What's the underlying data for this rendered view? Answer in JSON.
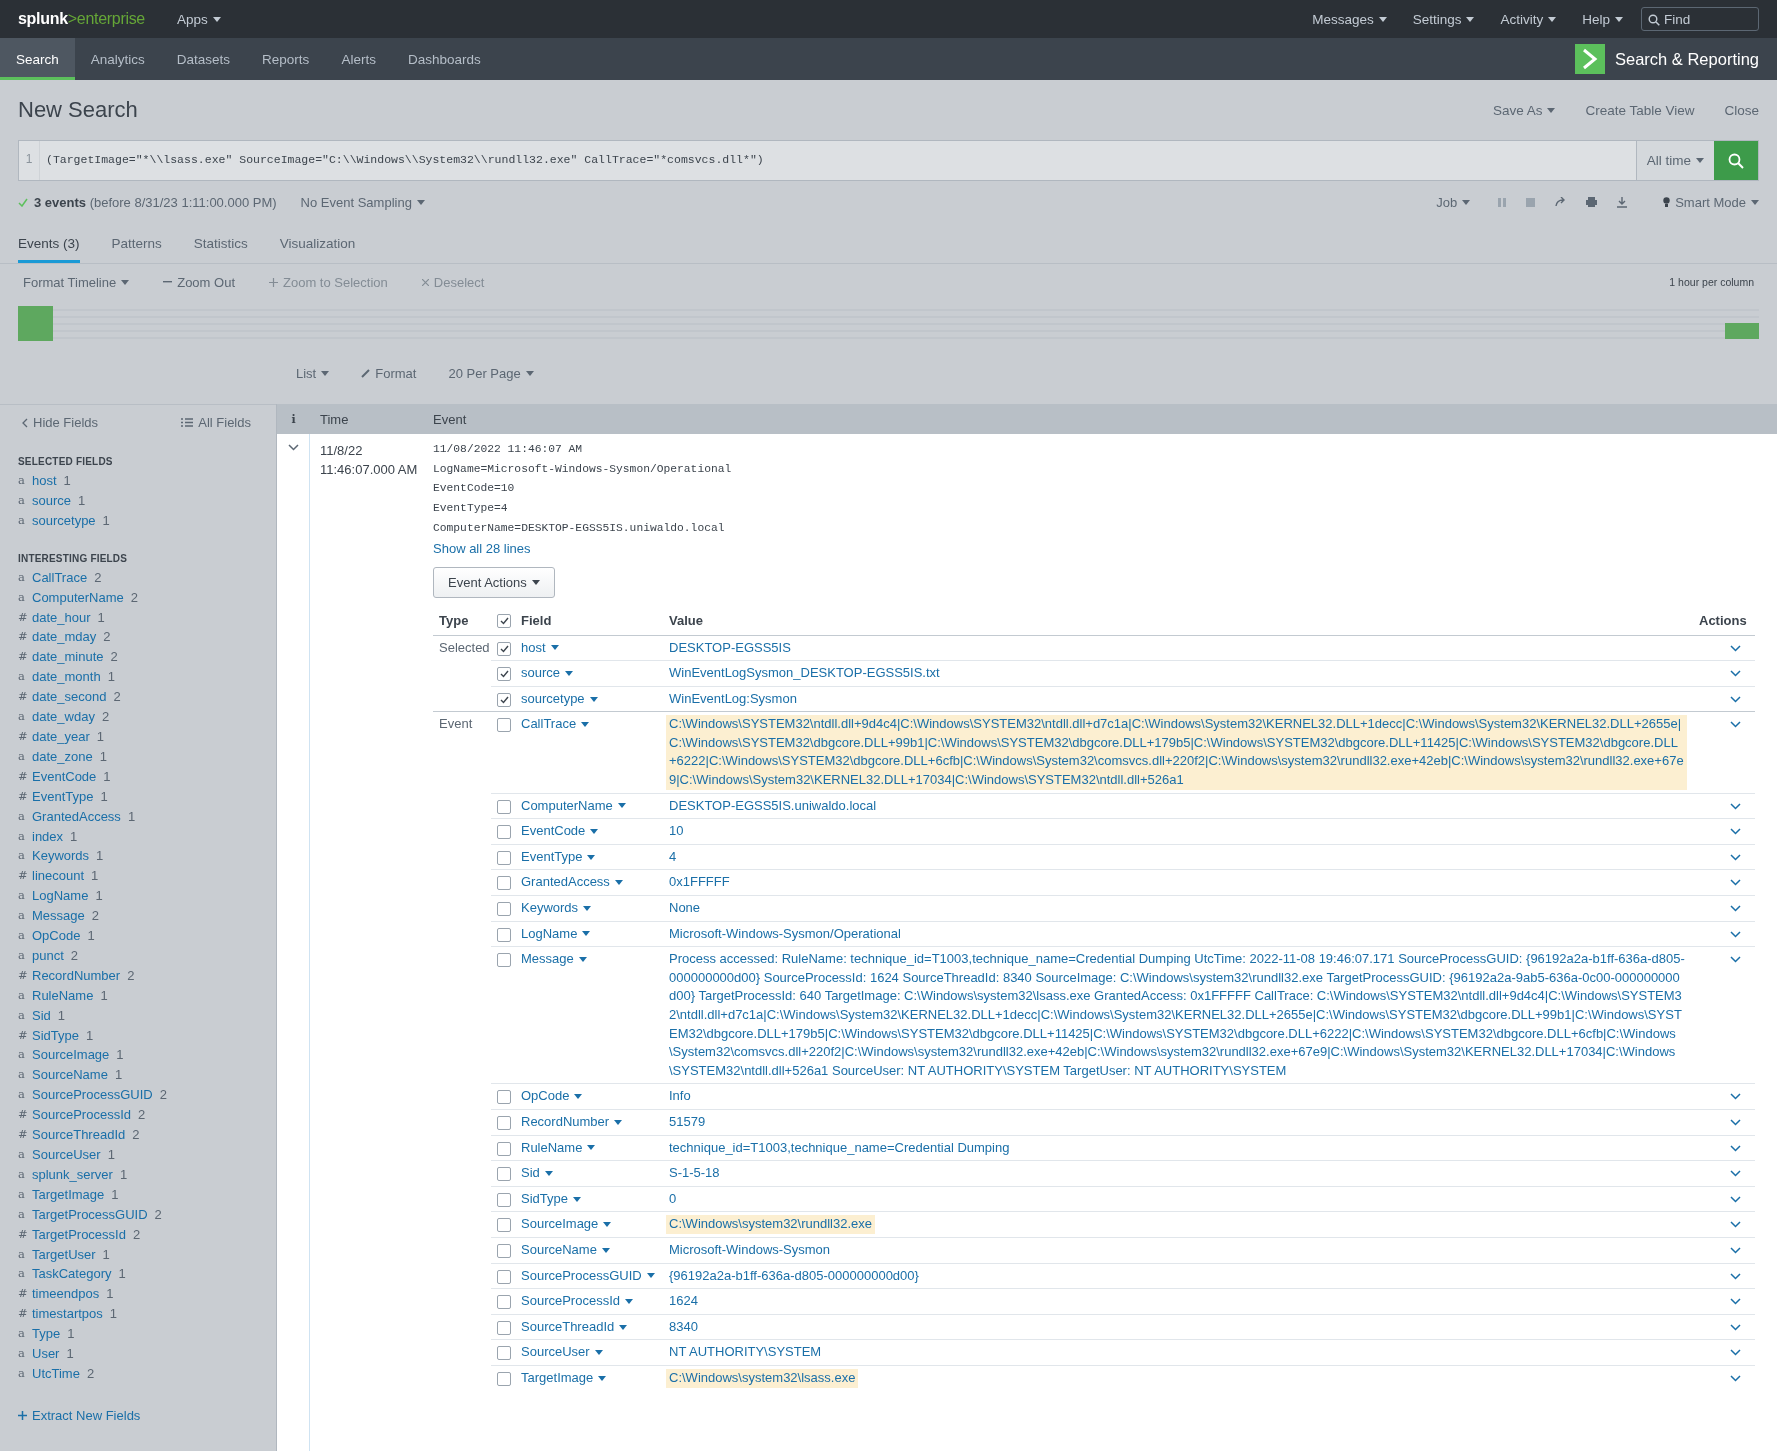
{
  "top_bar": {
    "logo": {
      "name": "splunk",
      "product": ">enterprise"
    },
    "apps": "Apps",
    "menus": [
      "Messages",
      "Settings",
      "Activity",
      "Help"
    ],
    "find": {
      "placeholder": "Find"
    }
  },
  "nav": {
    "items": [
      {
        "label": "Search",
        "selected": true
      },
      {
        "label": "Analytics",
        "selected": false
      },
      {
        "label": "Datasets",
        "selected": false
      },
      {
        "label": "Reports",
        "selected": false
      },
      {
        "label": "Alerts",
        "selected": false
      },
      {
        "label": "Dashboards",
        "selected": false
      }
    ],
    "app_title": "Search & Reporting"
  },
  "header": {
    "title": "New Search",
    "actions": [
      {
        "label": "Save As",
        "dropdown": true
      },
      {
        "label": "Create Table View",
        "dropdown": false
      },
      {
        "label": "Close",
        "dropdown": false
      }
    ]
  },
  "search": {
    "line_number": "1",
    "query": "(TargetImage=\"*\\\\lsass.exe\" SourceImage=\"C:\\\\Windows\\\\System32\\\\rundll32.exe\" CallTrace=\"*comsvcs.dll*\")",
    "time_range": "All time"
  },
  "status": {
    "count": "3 events",
    "detail": "(before 8/31/23 1:11:00.000 PM)",
    "sampling": "No Event Sampling",
    "job": "Job",
    "mode": "Smart Mode"
  },
  "tabs": [
    {
      "label": "Events (3)",
      "selected": true
    },
    {
      "label": "Patterns",
      "selected": false
    },
    {
      "label": "Statistics",
      "selected": false
    },
    {
      "label": "Visualization",
      "selected": false
    }
  ],
  "timeline": {
    "format": "Format Timeline",
    "zoom_out": {
      "label": "Zoom Out",
      "disabled": false
    },
    "zoom_selection": {
      "label": "Zoom to Selection",
      "disabled": true
    },
    "deselect": {
      "label": "Deselect",
      "disabled": true
    },
    "scale": "1 hour per column"
  },
  "results_toolbar": [
    {
      "label": "List",
      "kind": "dropdown"
    },
    {
      "label": "Format",
      "kind": "edit"
    },
    {
      "label": "20 Per Page",
      "kind": "dropdown"
    }
  ],
  "sidebar": {
    "hide": "Hide Fields",
    "all": "All Fields",
    "selected_heading": "SELECTED FIELDS",
    "selected_fields": [
      {
        "type": "a",
        "name": "host",
        "count": "1"
      },
      {
        "type": "a",
        "name": "source",
        "count": "1"
      },
      {
        "type": "a",
        "name": "sourcetype",
        "count": "1"
      }
    ],
    "interesting_heading": "INTERESTING FIELDS",
    "interesting_fields": [
      {
        "type": "a",
        "name": "CallTrace",
        "count": "2"
      },
      {
        "type": "a",
        "name": "ComputerName",
        "count": "2"
      },
      {
        "type": "#",
        "name": "date_hour",
        "count": "1"
      },
      {
        "type": "#",
        "name": "date_mday",
        "count": "2"
      },
      {
        "type": "#",
        "name": "date_minute",
        "count": "2"
      },
      {
        "type": "a",
        "name": "date_month",
        "count": "1"
      },
      {
        "type": "#",
        "name": "date_second",
        "count": "2"
      },
      {
        "type": "a",
        "name": "date_wday",
        "count": "2"
      },
      {
        "type": "#",
        "name": "date_year",
        "count": "1"
      },
      {
        "type": "a",
        "name": "date_zone",
        "count": "1"
      },
      {
        "type": "#",
        "name": "EventCode",
        "count": "1"
      },
      {
        "type": "#",
        "name": "EventType",
        "count": "1"
      },
      {
        "type": "a",
        "name": "GrantedAccess",
        "count": "1"
      },
      {
        "type": "a",
        "name": "index",
        "count": "1"
      },
      {
        "type": "a",
        "name": "Keywords",
        "count": "1"
      },
      {
        "type": "#",
        "name": "linecount",
        "count": "1"
      },
      {
        "type": "a",
        "name": "LogName",
        "count": "1"
      },
      {
        "type": "a",
        "name": "Message",
        "count": "2"
      },
      {
        "type": "a",
        "name": "OpCode",
        "count": "1"
      },
      {
        "type": "a",
        "name": "punct",
        "count": "2"
      },
      {
        "type": "#",
        "name": "RecordNumber",
        "count": "2"
      },
      {
        "type": "a",
        "name": "RuleName",
        "count": "1"
      },
      {
        "type": "a",
        "name": "Sid",
        "count": "1"
      },
      {
        "type": "#",
        "name": "SidType",
        "count": "1"
      },
      {
        "type": "a",
        "name": "SourceImage",
        "count": "1"
      },
      {
        "type": "a",
        "name": "SourceName",
        "count": "1"
      },
      {
        "type": "a",
        "name": "SourceProcessGUID",
        "count": "2"
      },
      {
        "type": "#",
        "name": "SourceProcessId",
        "count": "2"
      },
      {
        "type": "#",
        "name": "SourceThreadId",
        "count": "2"
      },
      {
        "type": "a",
        "name": "SourceUser",
        "count": "1"
      },
      {
        "type": "a",
        "name": "splunk_server",
        "count": "1"
      },
      {
        "type": "a",
        "name": "TargetImage",
        "count": "1"
      },
      {
        "type": "a",
        "name": "TargetProcessGUID",
        "count": "2"
      },
      {
        "type": "#",
        "name": "TargetProcessId",
        "count": "2"
      },
      {
        "type": "a",
        "name": "TargetUser",
        "count": "1"
      },
      {
        "type": "a",
        "name": "TaskCategory",
        "count": "1"
      },
      {
        "type": "#",
        "name": "timeendpos",
        "count": "1"
      },
      {
        "type": "#",
        "name": "timestartpos",
        "count": "1"
      },
      {
        "type": "a",
        "name": "Type",
        "count": "1"
      },
      {
        "type": "a",
        "name": "User",
        "count": "1"
      },
      {
        "type": "a",
        "name": "UtcTime",
        "count": "2"
      }
    ],
    "extract": "Extract New Fields"
  },
  "events_table": {
    "columns": [
      "i",
      "Time",
      "Event"
    ],
    "event": {
      "expanded": true,
      "date": "11/8/22",
      "time": "11:46:07.000 AM",
      "raw_lines": [
        "11/08/2022 11:46:07 AM",
        "LogName=Microsoft-Windows-Sysmon/Operational",
        "EventCode=10",
        "EventType=4",
        "ComputerName=DESKTOP-EGSS5IS.uniwaldo.local"
      ],
      "show_all": "Show all 28 lines",
      "event_actions": "Event Actions",
      "fields": {
        "columns": [
          "Type",
          "Field",
          "Value",
          "Actions"
        ],
        "all_checked": true,
        "rows": [
          {
            "type": "Selected",
            "field": "host",
            "value": "DESKTOP-EGSS5IS",
            "checked": true,
            "highlighted": false
          },
          {
            "field": "source",
            "value": "WinEventLogSysmon_DESKTOP-EGSS5IS.txt",
            "checked": true,
            "highlighted": false
          },
          {
            "field": "sourcetype",
            "value": "WinEventLog:Sysmon",
            "checked": true,
            "highlighted": false
          },
          {
            "type": "Event",
            "field": "CallTrace",
            "value": "C:\\Windows\\SYSTEM32\\ntdll.dll+9d4c4|C:\\Windows\\SYSTEM32\\ntdll.dll+d7c1a|C:\\Windows\\System32\\KERNEL32.DLL+1decc|C:\\Windows\\System32\\KERNEL32.DLL+2655e|C:\\Windows\\SYSTEM32\\dbgcore.DLL+99b1|C:\\Windows\\SYSTEM32\\dbgcore.DLL+179b5|C:\\Windows\\SYSTEM32\\dbgcore.DLL+11425|C:\\Windows\\SYSTEM32\\dbgcore.DLL+6222|C:\\Windows\\SYSTEM32\\dbgcore.DLL+6cfb|C:\\Windows\\System32\\comsvcs.dll+220f2|C:\\Windows\\system32\\rundll32.exe+42eb|C:\\Windows\\system32\\rundll32.exe+67e9|C:\\Windows\\System32\\KERNEL32.DLL+17034|C:\\Windows\\SYSTEM32\\ntdll.dll+526a1",
            "checked": false,
            "highlighted": true
          },
          {
            "field": "ComputerName",
            "value": "DESKTOP-EGSS5IS.uniwaldo.local",
            "checked": false,
            "highlighted": false
          },
          {
            "field": "EventCode",
            "value": "10",
            "checked": false,
            "highlighted": false
          },
          {
            "field": "EventType",
            "value": "4",
            "checked": false,
            "highlighted": false
          },
          {
            "field": "GrantedAccess",
            "value": "0x1FFFFF",
            "checked": false,
            "highlighted": false
          },
          {
            "field": "Keywords",
            "value": "None",
            "checked": false,
            "highlighted": false
          },
          {
            "field": "LogName",
            "value": "Microsoft-Windows-Sysmon/Operational",
            "checked": false,
            "highlighted": false
          },
          {
            "field": "Message",
            "value": "Process accessed: RuleName: technique_id=T1003,technique_name=Credential Dumping UtcTime: 2022-11-08 19:46:07.171 SourceProcessGUID: {96192a2a-b1ff-636a-d805-000000000d00} SourceProcessId: 1624 SourceThreadId: 8340 SourceImage: C:\\Windows\\system32\\rundll32.exe TargetProcessGUID: {96192a2a-9ab5-636a-0c00-000000000d00} TargetProcessId: 640 TargetImage: C:\\Windows\\system32\\lsass.exe GrantedAccess: 0x1FFFFF CallTrace: C:\\Windows\\SYSTEM32\\ntdll.dll+9d4c4|C:\\Windows\\SYSTEM32\\ntdll.dll+d7c1a|C:\\Windows\\System32\\KERNEL32.DLL+1decc|C:\\Windows\\System32\\KERNEL32.DLL+2655e|C:\\Windows\\SYSTEM32\\dbgcore.DLL+99b1|C:\\Windows\\SYSTEM32\\dbgcore.DLL+179b5|C:\\Windows\\SYSTEM32\\dbgcore.DLL+11425|C:\\Windows\\SYSTEM32\\dbgcore.DLL+6222|C:\\Windows\\SYSTEM32\\dbgcore.DLL+6cfb|C:\\Windows\\System32\\comsvcs.dll+220f2|C:\\Windows\\system32\\rundll32.exe+42eb|C:\\Windows\\system32\\rundll32.exe+67e9|C:\\Windows\\System32\\KERNEL32.DLL+17034|C:\\Windows\\SYSTEM32\\ntdll.dll+526a1 SourceUser: NT AUTHORITY\\SYSTEM TargetUser: NT AUTHORITY\\SYSTEM",
            "checked": false,
            "highlighted": false
          },
          {
            "field": "OpCode",
            "value": "Info",
            "checked": false,
            "highlighted": false
          },
          {
            "field": "RecordNumber",
            "value": "51579",
            "checked": false,
            "highlighted": false
          },
          {
            "field": "RuleName",
            "value": "technique_id=T1003,technique_name=Credential Dumping",
            "checked": false,
            "highlighted": false
          },
          {
            "field": "Sid",
            "value": "S-1-5-18",
            "checked": false,
            "highlighted": false
          },
          {
            "field": "SidType",
            "value": "0",
            "checked": false,
            "highlighted": false
          },
          {
            "field": "SourceImage",
            "value": "C:\\Windows\\system32\\rundll32.exe",
            "checked": false,
            "highlighted": true
          },
          {
            "field": "SourceName",
            "value": "Microsoft-Windows-Sysmon",
            "checked": false,
            "highlighted": false
          },
          {
            "field": "SourceProcessGUID",
            "value": "{96192a2a-b1ff-636a-d805-000000000d00}",
            "checked": false,
            "highlighted": false
          },
          {
            "field": "SourceProcessId",
            "value": "1624",
            "checked": false,
            "highlighted": false
          },
          {
            "field": "SourceThreadId",
            "value": "8340",
            "checked": false,
            "highlighted": false
          },
          {
            "field": "SourceUser",
            "value": "NT AUTHORITY\\SYSTEM",
            "checked": false,
            "highlighted": false
          },
          {
            "field": "TargetImage",
            "value": "C:\\Windows\\system32\\lsass.exe",
            "checked": false,
            "highlighted": true
          }
        ]
      }
    }
  }
}
